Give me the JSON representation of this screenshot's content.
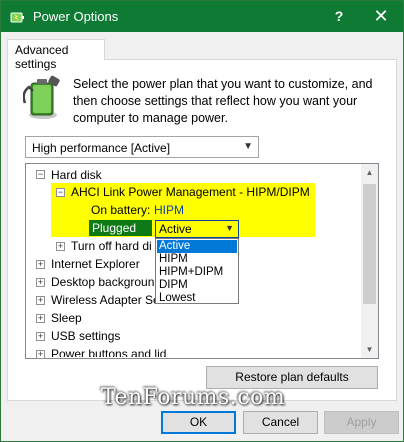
{
  "window": {
    "title": "Power Options",
    "help_label": "?",
    "close_label": "✕"
  },
  "tab": {
    "label": "Advanced settings"
  },
  "description": "Select the power plan that you want to customize, and then choose settings that reflect how you want your computer to manage power.",
  "plan_select": {
    "value": "High performance [Active]"
  },
  "tree": {
    "hard_disk": "Hard disk",
    "ahci": "AHCI Link Power Management - HIPM/DIPM",
    "on_battery_label": "On battery:",
    "on_battery_value": "HIPM",
    "plugged_in_label": "Plugged in:",
    "plugged_in_value": "Active",
    "turn_off": "Turn off hard di",
    "items": [
      "Internet Explorer",
      "Desktop backgroun",
      "Wireless Adapter Se",
      "Sleep",
      "USB settings",
      "Power buttons and lid"
    ]
  },
  "dropdown": {
    "options": [
      "Active",
      "HIPM",
      "HIPM+DIPM",
      "DIPM",
      "Lowest"
    ]
  },
  "buttons": {
    "restore": "Restore plan defaults",
    "ok": "OK",
    "cancel": "Cancel",
    "apply": "Apply"
  },
  "watermark": "TenForums.com",
  "colors": {
    "titlebar": "#0f7a33",
    "highlight_yellow": "#ffff00",
    "plugged_green": "#0e7a16",
    "setting_blue": "#0a44a0",
    "selection_blue": "#0078d7"
  }
}
